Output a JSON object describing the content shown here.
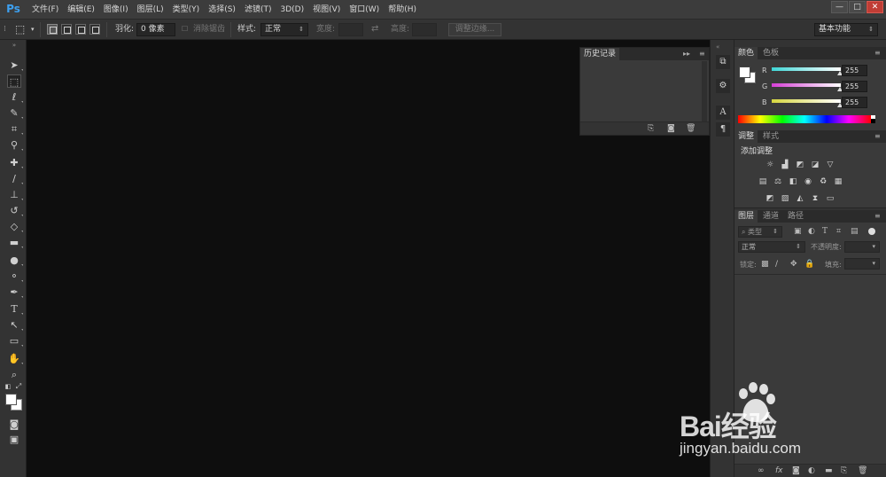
{
  "app": {
    "logo": "Ps"
  },
  "menu": [
    "文件(F)",
    "编辑(E)",
    "图像(I)",
    "图层(L)",
    "类型(Y)",
    "选择(S)",
    "滤镜(T)",
    "3D(D)",
    "视图(V)",
    "窗口(W)",
    "帮助(H)"
  ],
  "window_buttons": {
    "minimize": "—",
    "maximize": "□",
    "close": "✕"
  },
  "options": {
    "feather_label": "羽化:",
    "feather_value": "0 像素",
    "antialias_label": "消除锯齿",
    "style_label": "样式:",
    "style_value": "正常",
    "width_label": "宽度:",
    "height_label": "高度:",
    "refine_edge": "调整边缘...",
    "workspace": "基本功能"
  },
  "history_panel": {
    "tab": "历史记录"
  },
  "color_panel": {
    "tabs": [
      "颜色",
      "色板"
    ],
    "channels": [
      {
        "label": "R",
        "value": "255",
        "color": "#3fd6d6"
      },
      {
        "label": "G",
        "value": "255",
        "color": "#d53fd5"
      },
      {
        "label": "B",
        "value": "255",
        "color": "#d6d63f"
      }
    ]
  },
  "adjust_panel": {
    "tabs": [
      "调整",
      "样式"
    ],
    "heading": "添加调整"
  },
  "layers_panel": {
    "tabs": [
      "图层",
      "通道",
      "路径"
    ],
    "filter_kind": "类型",
    "blend_mode": "正常",
    "opacity_label": "不透明度:",
    "lock_label": "锁定:",
    "fill_label": "填充:"
  },
  "watermark": {
    "text": "Bai经验",
    "url": "jingyan.baidu.com"
  }
}
